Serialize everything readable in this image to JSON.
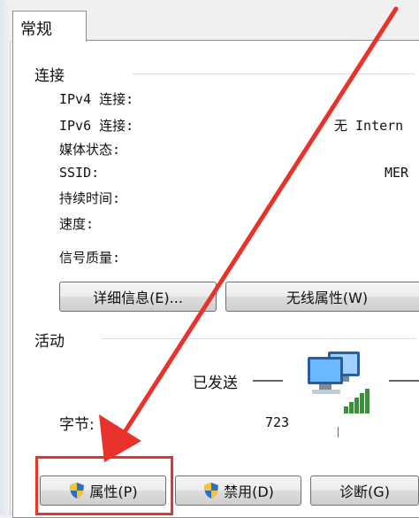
{
  "tab": {
    "label": "常规"
  },
  "connection": {
    "title": "连接",
    "rows": [
      {
        "label": "IPv4 连接:",
        "value": ""
      },
      {
        "label": "IPv6 连接:",
        "value": "无 Intern"
      },
      {
        "label": "媒体状态:",
        "value": ""
      },
      {
        "label": "SSID:",
        "value": "MER"
      },
      {
        "label": "持续时间:",
        "value": ""
      },
      {
        "label": "速度:",
        "value": ""
      }
    ],
    "signal_label": "信号质量:",
    "details_button": "详细信息(E)...",
    "wireless_button": "无线属性(W)"
  },
  "activity": {
    "title": "活动",
    "sent_label": "已发送",
    "bytes_label": "字节:",
    "bytes_sent": "723"
  },
  "buttons": {
    "properties": "属性(P)",
    "disable": "禁用(D)",
    "diagnose": "诊断(G)"
  },
  "colors": {
    "annotation_red": "#e8322b",
    "panel_border": "#8e8f8f",
    "signal_green": "#2e9a2e"
  },
  "icons": {
    "network_activity": "computers-network-icon",
    "shield": "uac-shield-icon"
  }
}
